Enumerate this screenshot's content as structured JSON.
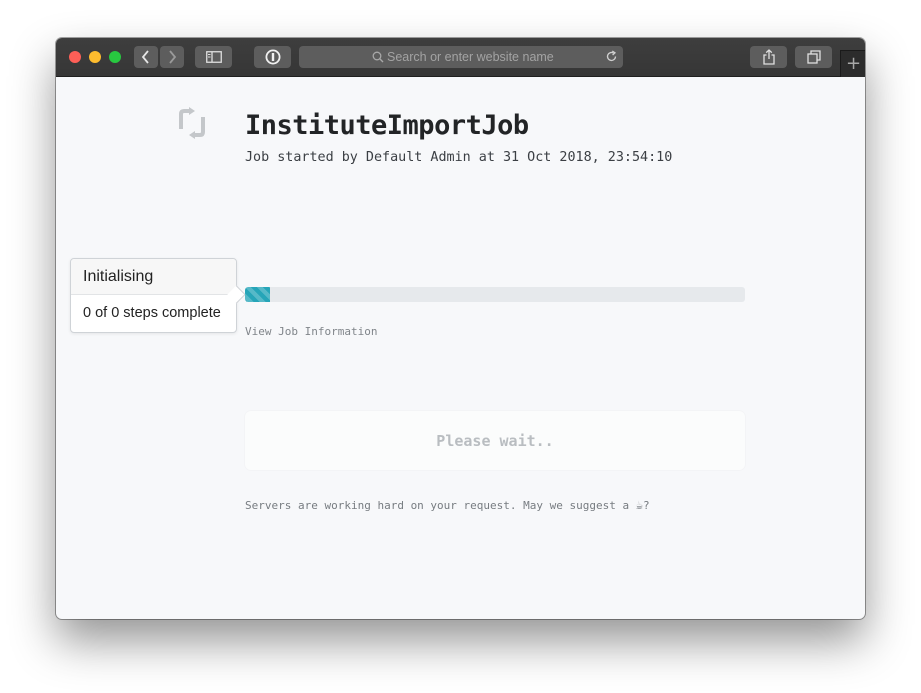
{
  "browser": {
    "search_placeholder": "Search or enter website name",
    "newtab_label": "+",
    "back_icon": "chevron-left-icon",
    "forward_icon": "chevron-right-icon"
  },
  "job": {
    "title": "InstituteImportJob",
    "meta": "Job started by Default Admin at 31 Oct 2018, 23:54:10",
    "progress_fraction": 0.05,
    "view_info_link": "View Job Information"
  },
  "status_tooltip": {
    "heading": "Initialising",
    "steps_text": "0 of 0 steps complete"
  },
  "wait": {
    "box_text": "Please wait..",
    "note_text": "Servers are working hard on your request. May we suggest a ",
    "coffee_glyph": "☕",
    "note_suffix": "?"
  },
  "colors": {
    "progress_fill": "#26a5b8",
    "progress_track": "#e6e9ec",
    "page_bg": "#f7f8fa"
  }
}
